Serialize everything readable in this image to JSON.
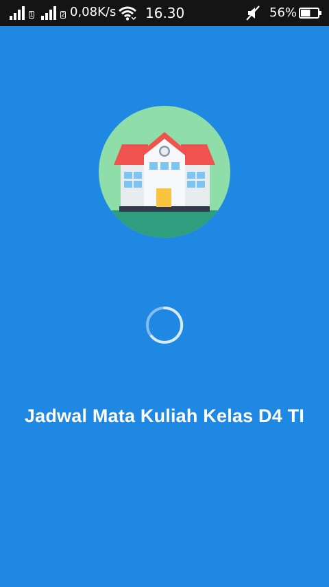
{
  "status_bar": {
    "sim1_label": "1",
    "sim2_label": "2",
    "network_speed": "0,08K/s",
    "time": "16.30",
    "battery_percent": "56%",
    "battery_level": 0.56,
    "icons": [
      "signal-icon",
      "signal-icon",
      "wifi-icon",
      "mute-icon",
      "battery-icon"
    ]
  },
  "splash": {
    "logo_icon": "school-building-icon",
    "loading_icon": "loading-spinner-icon",
    "title": "Jadwal Mata Kuliah Kelas D4 TI"
  },
  "colors": {
    "background": "#1f88e3",
    "status_bar": "#141414",
    "logo_circle": "#8fdda8",
    "roof": "#ef5350",
    "door": "#f9c440"
  }
}
